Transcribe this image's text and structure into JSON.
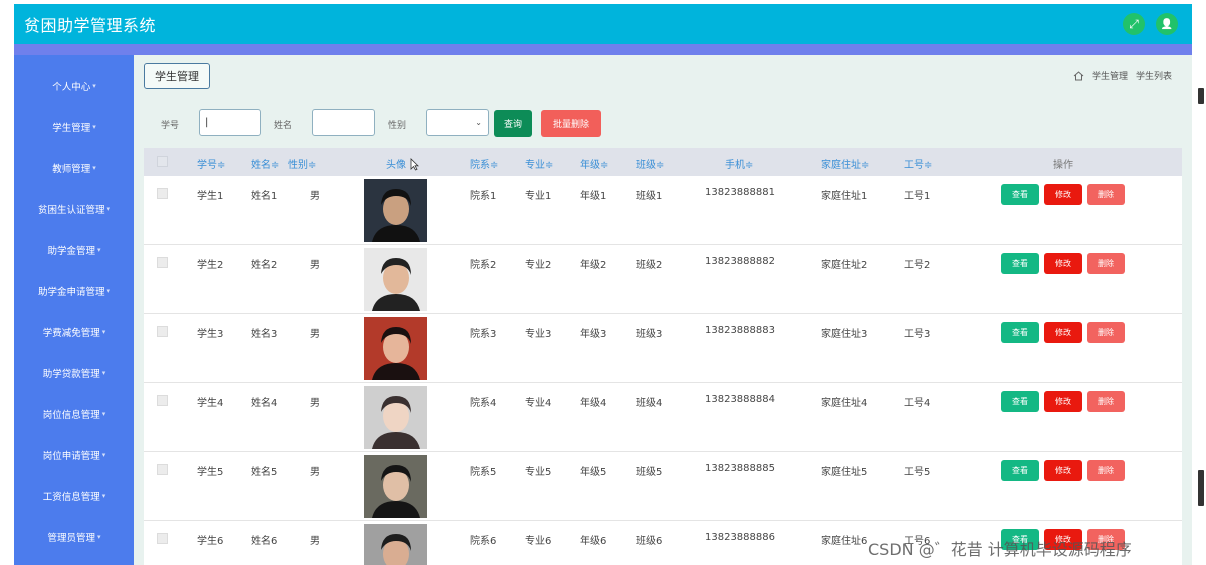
{
  "header": {
    "title": "贫困助学管理系统",
    "icons": [
      "fullscreen-icon",
      "user-icon"
    ],
    "fullscreen_glyph": "⤢",
    "user_glyph": "👤",
    "accent": "#00b4dc"
  },
  "sidebar": {
    "items": [
      {
        "label": "个人中心"
      },
      {
        "label": "学生管理"
      },
      {
        "label": "教师管理"
      },
      {
        "label": "贫困生认证管理"
      },
      {
        "label": "助学金管理"
      },
      {
        "label": "助学金申请管理"
      },
      {
        "label": "学费减免管理"
      },
      {
        "label": "助学贷款管理"
      },
      {
        "label": "岗位信息管理"
      },
      {
        "label": "岗位申请管理"
      },
      {
        "label": "工资信息管理"
      },
      {
        "label": "管理员管理"
      }
    ]
  },
  "content": {
    "tab_label": "学生管理",
    "breadcrumb": [
      "学生管理",
      "学生列表"
    ]
  },
  "filters": {
    "student_no_label": "学号",
    "student_no_value": "|",
    "name_label": "姓名",
    "name_value": "",
    "gender_label": "性别",
    "gender_value": "",
    "query_label": "查询",
    "batch_delete_label": "批量删除"
  },
  "table": {
    "headers": {
      "student_no": "学号≑",
      "name": "姓名≑",
      "gender": "性别≑",
      "avatar": "头像",
      "faculty": "院系≑",
      "major": "专业≑",
      "grade": "年级≑",
      "klass": "班级≑",
      "phone": "手机≑",
      "address": "家庭住址≑",
      "job_no": "工号≑",
      "actions": "操作"
    },
    "action_labels": {
      "view": "查看",
      "edit": "修改",
      "delete": "删除"
    },
    "rows": [
      {
        "student_no": "学生1",
        "name": "姓名1",
        "gender": "男",
        "faculty": "院系1",
        "major": "专业1",
        "grade": "年级1",
        "klass": "班级1",
        "phone": "13823888881",
        "address": "家庭住址1",
        "job_no": "工号1"
      },
      {
        "student_no": "学生2",
        "name": "姓名2",
        "gender": "男",
        "faculty": "院系2",
        "major": "专业2",
        "grade": "年级2",
        "klass": "班级2",
        "phone": "13823888882",
        "address": "家庭住址2",
        "job_no": "工号2"
      },
      {
        "student_no": "学生3",
        "name": "姓名3",
        "gender": "男",
        "faculty": "院系3",
        "major": "专业3",
        "grade": "年级3",
        "klass": "班级3",
        "phone": "13823888883",
        "address": "家庭住址3",
        "job_no": "工号3"
      },
      {
        "student_no": "学生4",
        "name": "姓名4",
        "gender": "男",
        "faculty": "院系4",
        "major": "专业4",
        "grade": "年级4",
        "klass": "班级4",
        "phone": "13823888884",
        "address": "家庭住址4",
        "job_no": "工号4"
      },
      {
        "student_no": "学生5",
        "name": "姓名5",
        "gender": "男",
        "faculty": "院系5",
        "major": "专业5",
        "grade": "年级5",
        "klass": "班级5",
        "phone": "13823888885",
        "address": "家庭住址5",
        "job_no": "工号5"
      },
      {
        "student_no": "学生6",
        "name": "姓名6",
        "gender": "男",
        "faculty": "院系6",
        "major": "专业6",
        "grade": "年级6",
        "klass": "班级6",
        "phone": "13823888886",
        "address": "家庭住址6",
        "job_no": "工号6"
      }
    ]
  },
  "watermark": "CSDN @゛花昔 计算机毕设源码程序"
}
